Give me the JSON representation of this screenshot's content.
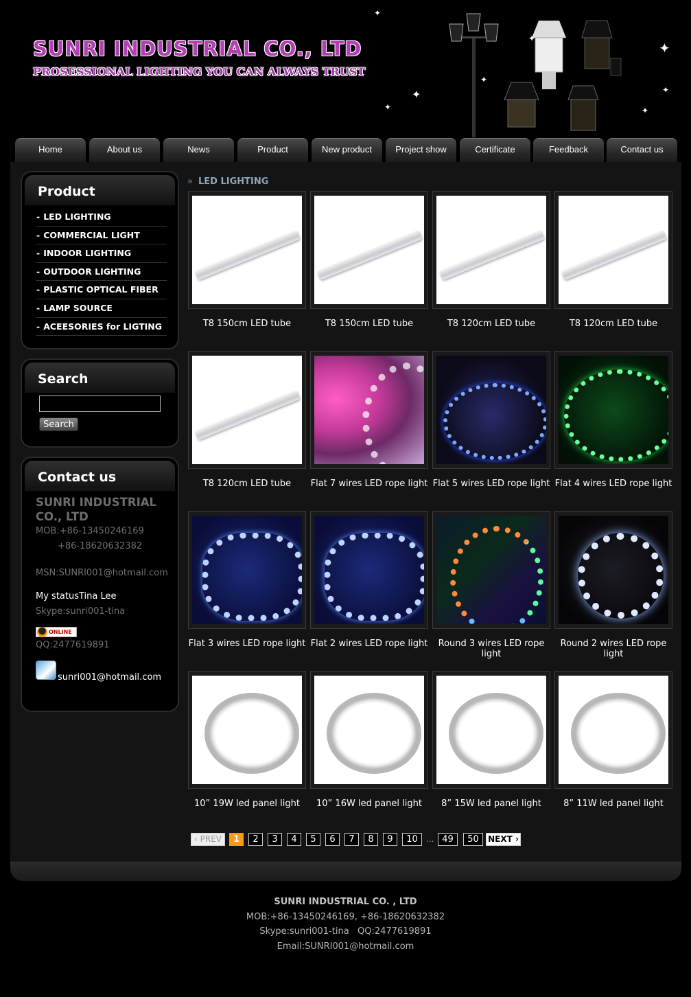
{
  "header": {
    "company_title": "SUNRI INDUSTRIAL CO., LTD",
    "slogan": "PROSESSIONAL LIGHTING YOU CAN ALWAYS TRUST"
  },
  "nav": {
    "items": [
      "Home",
      "About us",
      "News",
      "Product",
      "New product",
      "Project show",
      "Certificate",
      "Feedback",
      "Contact  us"
    ]
  },
  "sidebar": {
    "product_title": "Product",
    "product_items": [
      "LED LIGHTING",
      "COMMERCIAL LIGHT",
      "INDOOR LIGHTING",
      "OUTDOOR LIGHTING",
      "PLASTIC OPTICAL FIBER",
      "LAMP SOURCE",
      "ACEESORIES for LIGTING"
    ],
    "search_title": "Search",
    "search_button": "Search",
    "search_value": "",
    "contact_title": "Contact us",
    "contact_company": "SUNRI INDUSTRIAL CO., LTD",
    "mob1": "MOB:+86-13450246169",
    "mob2": "+86-18620632382",
    "msn": "MSN:SUNRI001@hotmail.com",
    "status": "My statusTina Lee",
    "skype": "Skype:sunri001-tina",
    "online_badge": "ONLINE",
    "qq": "QQ:2477619891",
    "email": "sunri001@hotmail.com"
  },
  "breadcrumb": {
    "arrows": "»",
    "current": "LED LIGHTING"
  },
  "products": [
    {
      "name": "T8 150cm LED tube",
      "image": "tube"
    },
    {
      "name": "T8 150cm LED tube",
      "image": "tube"
    },
    {
      "name": "T8 120cm LED tube",
      "image": "tube"
    },
    {
      "name": "T8 120cm LED tube",
      "image": "tube"
    },
    {
      "name": "T8 120cm LED tube",
      "image": "tube"
    },
    {
      "name": "Flat 7 wires LED rope light",
      "image": "rope-pink"
    },
    {
      "name": "Flat 5 wires LED rope light",
      "image": "rope-blue"
    },
    {
      "name": "Flat 4 wires LED rope light",
      "image": "rope-green"
    },
    {
      "name": "Flat 3 wires LED rope light",
      "image": "rope-blue2"
    },
    {
      "name": "Flat 2 wires LED rope light",
      "image": "rope-blue2"
    },
    {
      "name": "Round 3 wires LED rope light",
      "image": "rope-multi"
    },
    {
      "name": "Round 2 wires LED rope light",
      "image": "rope-white"
    },
    {
      "name": "10” 19W led panel light",
      "image": "panel-light"
    },
    {
      "name": "10” 16W led panel light",
      "image": "panel-light"
    },
    {
      "name": "8” 15W led panel light",
      "image": "panel-light"
    },
    {
      "name": "8” 11W led panel light",
      "image": "panel-light"
    }
  ],
  "pagination": {
    "prev": "‹ PREV",
    "pages": [
      "1",
      "2",
      "3",
      "4",
      "5",
      "6",
      "7",
      "8",
      "9",
      "10"
    ],
    "ellipsis": "...",
    "last_pages": [
      "49",
      "50"
    ],
    "next": "NEXT ›",
    "current_page": 1
  },
  "footer": {
    "company": "SUNRI INDUSTRIAL CO. , LTD",
    "mob": "MOB:+86-13450246169, +86-18620632382",
    "skype_qq": "Skype:sunri001-tina   QQ:2477619891",
    "email": "Email:SUNRI001@hotmail.com"
  }
}
